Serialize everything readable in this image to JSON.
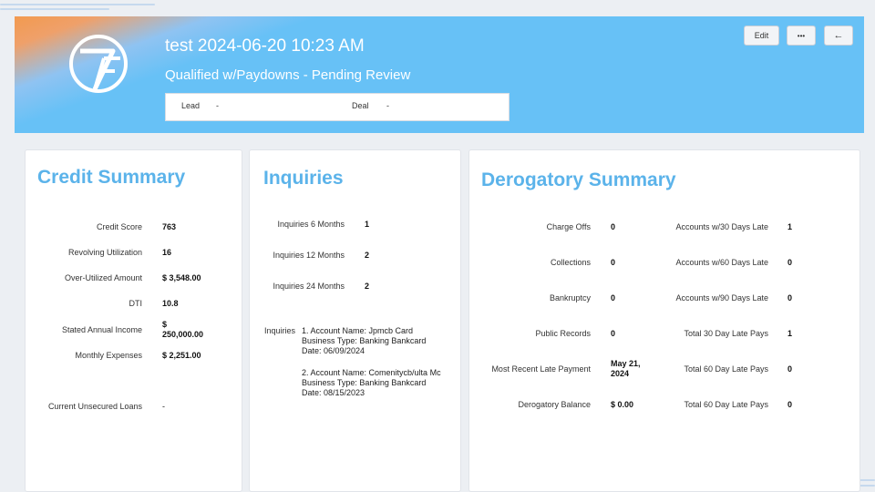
{
  "header": {
    "title": "test 2024-06-20 10:23 AM",
    "subtitle": "Qualified w/Paydowns - Pending Review",
    "lead_label": "Lead",
    "lead_value": "-",
    "deal_label": "Deal",
    "deal_value": "-",
    "edit_label": "Edit",
    "more_label": "•••",
    "back_label": "←"
  },
  "credit_summary": {
    "title": "Credit Summary",
    "credit_score_label": "Credit Score",
    "credit_score_value": "763",
    "revolving_label": "Revolving Utilization",
    "revolving_value": "16",
    "overutil_label": "Over-Utilized Amount",
    "overutil_value": "$ 3,548.00",
    "dti_label": "DTI",
    "dti_value": "10.8",
    "income_label": "Stated Annual Income",
    "income_value_1": "$",
    "income_value_2": "250,000.00",
    "expenses_label": "Monthly Expenses",
    "expenses_value": "$ 2,251.00",
    "loans_label": "Current Unsecured Loans",
    "loans_value": "-"
  },
  "inquiries": {
    "title": "Inquiries",
    "m6_label": "Inquiries 6 Months",
    "m6_value": "1",
    "m12_label": "Inquiries 12 Months",
    "m12_value": "2",
    "m24_label": "Inquiries 24 Months",
    "m24_value": "2",
    "list_label": "Inquiries",
    "item1_line1": "1. Account Name: Jpmcb Card",
    "item1_line2": "Business Type: Banking Bankcard",
    "item1_line3": "Date: 06/09/2024",
    "item2_line1": "2. Account Name: Comenitycb/ulta Mc",
    "item2_line2": "Business Type: Banking Bankcard",
    "item2_line3": "Date: 08/15/2023"
  },
  "derogatory": {
    "title": "Derogatory Summary",
    "chargeoffs_label": "Charge Offs",
    "chargeoffs_value": "0",
    "collections_label": "Collections",
    "collections_value": "0",
    "bankruptcy_label": "Bankruptcy",
    "bankruptcy_value": "0",
    "public_label": "Public Records",
    "public_value": "0",
    "recent_late_label": "Most Recent Late Payment",
    "recent_late_value_1": "May 21,",
    "recent_late_value_2": "2024",
    "balance_label": "Derogatory Balance",
    "balance_value": "$ 0.00",
    "late30_label": "Accounts w/30 Days Late",
    "late30_value": "1",
    "late60_label": "Accounts w/60 Days Late",
    "late60_value": "0",
    "late90_label": "Accounts w/90 Days Late",
    "late90_value": "0",
    "total30_label": "Total 30 Day Late Pays",
    "total30_value": "1",
    "total60_label": "Total 60 Day Late Pays",
    "total60_value": "0",
    "total60b_label": "Total 60 Day Late Pays",
    "total60b_value": "0"
  }
}
